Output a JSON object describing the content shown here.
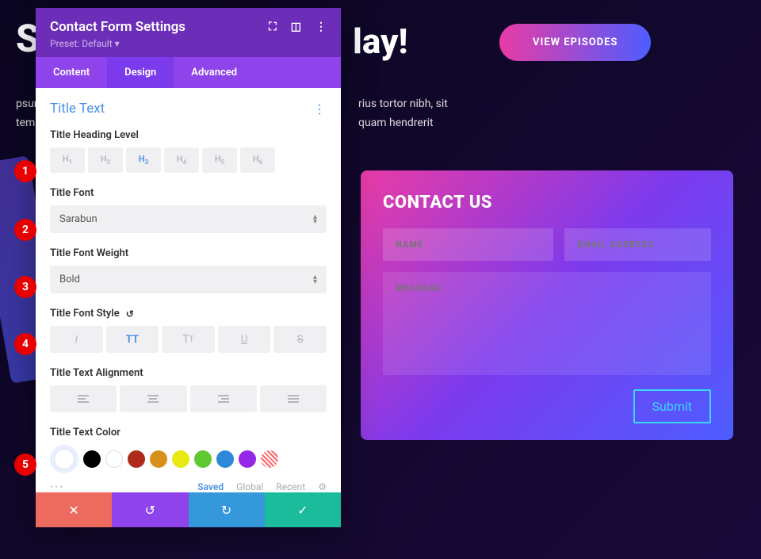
{
  "background": {
    "title_left": "St",
    "title_right": "lay!",
    "para1_left": "psum",
    "para1_right": "rius tortor nibh, sit",
    "para2_left": "temp",
    "para2_right": "quam hendrerit",
    "cta": "VIEW EPISODES"
  },
  "panel": {
    "title": "Contact Form Settings",
    "preset": "Preset: Default",
    "tabs": {
      "content": "Content",
      "design": "Design",
      "advanced": "Advanced"
    },
    "section": "Title Text",
    "labels": {
      "heading": "Title Heading Level",
      "font": "Title Font",
      "weight": "Title Font Weight",
      "style": "Title Font Style",
      "alignment": "Title Text Alignment",
      "color": "Title Text Color"
    },
    "headings": [
      "H1",
      "H2",
      "H3",
      "H4",
      "H5",
      "H6"
    ],
    "heading_active": "H3",
    "font_value": "Sarabun",
    "weight_value": "Bold",
    "palettes": {
      "saved": "Saved",
      "global": "Global",
      "recent": "Recent"
    },
    "colors": [
      "#000000",
      "#ffffff",
      "#b02b1c",
      "#d7901b",
      "#e8e812",
      "#5fc931",
      "#2c89d8",
      "#9428e6"
    ]
  },
  "contact": {
    "title": "CONTACT US",
    "name_placeholder": "NAME",
    "email_placeholder": "EMAIL ADDRESS",
    "message_placeholder": "MESSAGE",
    "submit": "Submit"
  },
  "badges": [
    "1",
    "2",
    "3",
    "4",
    "5"
  ]
}
